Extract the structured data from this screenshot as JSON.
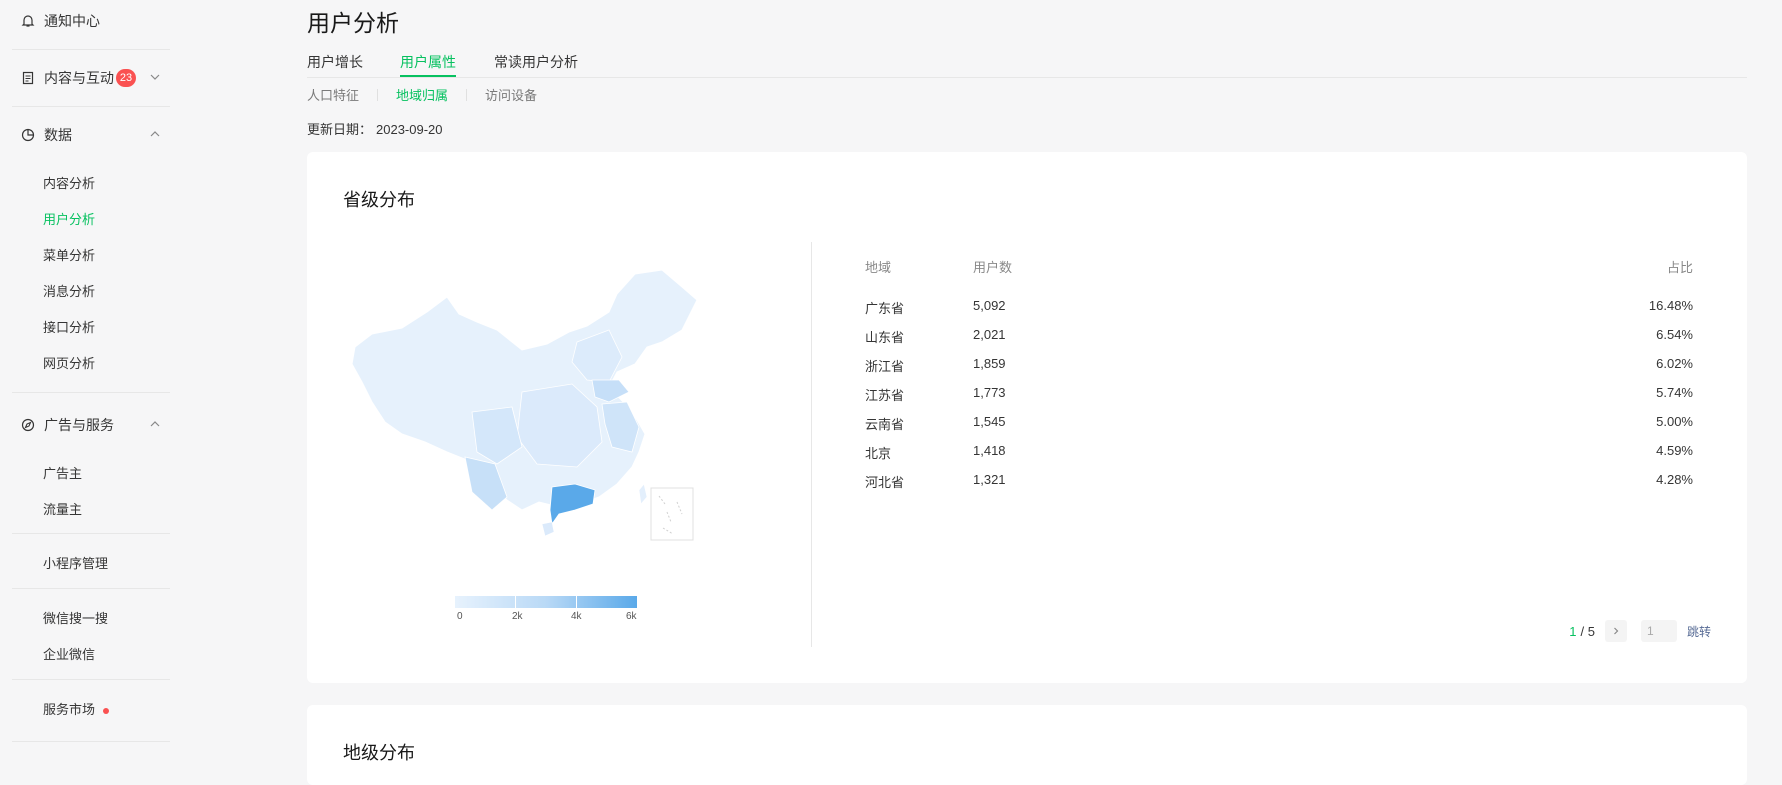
{
  "sidebar": {
    "notifications": "通知中心",
    "content": {
      "label": "内容与互动",
      "badge": "23"
    },
    "data": {
      "label": "数据",
      "items": [
        "内容分析",
        "用户分析",
        "菜单分析",
        "消息分析",
        "接口分析",
        "网页分析"
      ]
    },
    "ads": {
      "label": "广告与服务",
      "items": [
        "广告主",
        "流量主"
      ]
    },
    "miniprogram": "小程序管理",
    "search": "微信搜一搜",
    "wework": "企业微信",
    "market": "服务市场"
  },
  "page": {
    "title": "用户分析"
  },
  "tabs": [
    "用户增长",
    "用户属性",
    "常读用户分析"
  ],
  "subtabs": [
    "人口特征",
    "地域归属",
    "访问设备"
  ],
  "update": {
    "label": "更新日期：",
    "date": "2023-09-20"
  },
  "province_card": {
    "title": "省级分布",
    "legend": [
      "0",
      "2k",
      "4k",
      "6k"
    ],
    "table": {
      "headers": {
        "region": "地域",
        "users": "用户数",
        "ratio": "占比"
      },
      "rows": [
        {
          "region": "广东省",
          "users": "5,092",
          "ratio": "16.48%"
        },
        {
          "region": "山东省",
          "users": "2,021",
          "ratio": "6.54%"
        },
        {
          "region": "浙江省",
          "users": "1,859",
          "ratio": "6.02%"
        },
        {
          "region": "江苏省",
          "users": "1,773",
          "ratio": "5.74%"
        },
        {
          "region": "云南省",
          "users": "1,545",
          "ratio": "5.00%"
        },
        {
          "region": "北京",
          "users": "1,418",
          "ratio": "4.59%"
        },
        {
          "region": "河北省",
          "users": "1,321",
          "ratio": "4.28%"
        }
      ]
    },
    "pager": {
      "current": "1",
      "total": "/ 5",
      "input_placeholder": "1",
      "jump": "跳转"
    }
  },
  "city_card": {
    "title": "地级分布"
  },
  "colors": {
    "accent": "#07c160",
    "badge": "#fa5151",
    "map_low": "#e7f2fd",
    "map_high": "#5aa9e9"
  }
}
